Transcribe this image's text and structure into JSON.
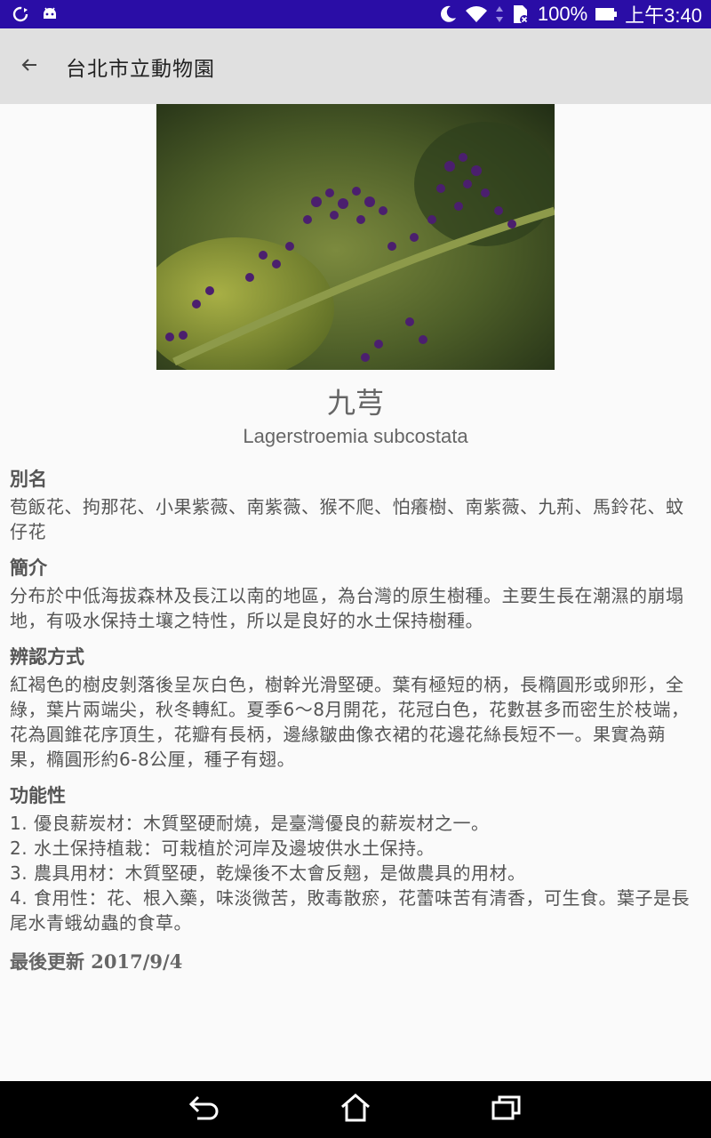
{
  "status_bar": {
    "battery": "100%",
    "time": "上午3:40",
    "icons": [
      "sync-icon",
      "android-debug-icon",
      "moon-icon",
      "wifi-icon",
      "data-transfer-icon",
      "sim-error-icon",
      "battery-icon"
    ]
  },
  "app_bar": {
    "title": "台北市立動物園",
    "back_icon": "arrow-back-icon"
  },
  "plant": {
    "name_zh": "九芎",
    "name_scientific": "Lagerstroemia subcostata"
  },
  "sections": {
    "alias": {
      "title": "別名",
      "body": "苞飯花、拘那花、小果紫薇、南紫薇、猴不爬、怕癢樹、南紫薇、九荊、馬鈴花、蚊仔花"
    },
    "intro": {
      "title": "簡介",
      "body": "分布於中低海拔森林及長江以南的地區，為台灣的原生樹種。主要生長在潮濕的崩塌地，有吸水保持土壤之特性，所以是良好的水土保持樹種。"
    },
    "identify": {
      "title": "辨認方式",
      "body": "紅褐色的樹皮剝落後呈灰白色，樹幹光滑堅硬。葉有極短的柄，長橢圓形或卵形，全綠，葉片兩端尖，秋冬轉紅。夏季6～8月開花，花冠白色，花數甚多而密生於枝端，花為圓錐花序頂生，花瓣有長柄，邊緣皺曲像衣裙的花邊花絲長短不一。果實為蒴果，橢圓形約6-8公厘，種子有翅。"
    },
    "function": {
      "title": "功能性",
      "items": [
        "1. 優良薪炭材：木質堅硬耐燒，是臺灣優良的薪炭材之一。",
        "2. 水土保持植栽：可栽植於河岸及邊坡供水土保持。",
        "3. 農具用材：木質堅硬，乾燥後不太會反翹，是做農具的用材。",
        "4. 食用性：花、根入藥，味淡微苦，敗毒散瘀，花蕾味苦有清香，可生食。葉子是長尾水青蛾幼蟲的食草。"
      ]
    },
    "updated": "最後更新 2017/9/4"
  },
  "nav_bar": {
    "icons": [
      "back-nav-icon",
      "home-nav-icon",
      "recents-nav-icon"
    ]
  }
}
